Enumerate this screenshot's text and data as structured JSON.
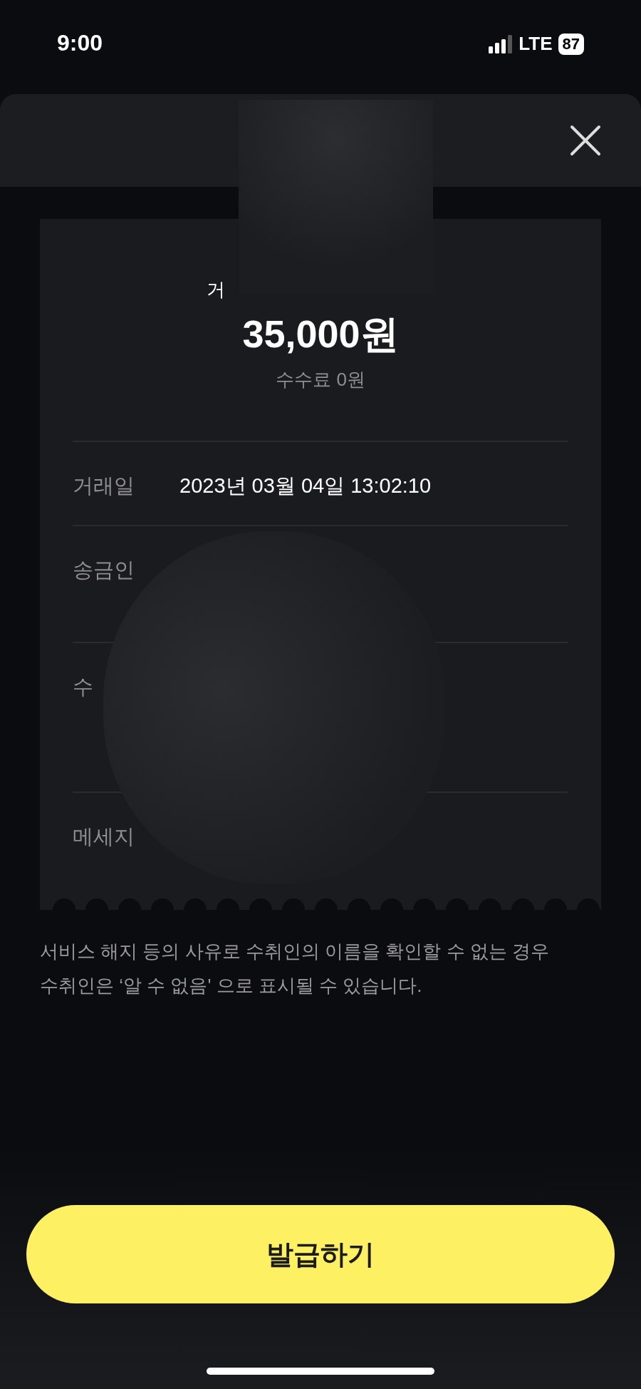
{
  "status_bar": {
    "time": "9:00",
    "network": "LTE",
    "battery": "87"
  },
  "receipt": {
    "title": "거",
    "amount": "35,000원",
    "fee": "수수료 0원",
    "rows": [
      {
        "label": "거래일",
        "value": "2023년 03월 04일 13:02:10"
      },
      {
        "label": "송금인"
      },
      {
        "label": "수"
      },
      {
        "label": "메세지"
      }
    ]
  },
  "notice": "서비스 해지 등의 사유로 수취인의 이름을 확인할 수 없는 경우 수취인은 ‘알 수 없음' 으로 표시될 수 있습니다.",
  "button": "발급하기"
}
